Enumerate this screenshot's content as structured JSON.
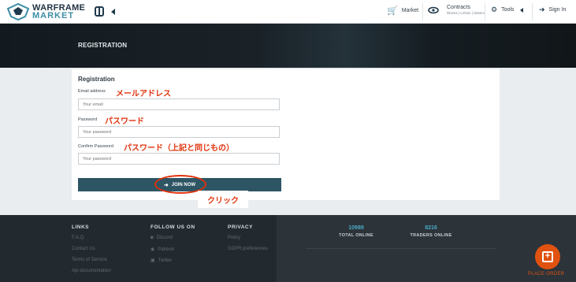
{
  "navbar": {
    "logo_line1": "WARFRAME",
    "logo_line2": "MARKET",
    "market_label": "Market",
    "contracts_label": "Contracts",
    "contracts_sub": "Rivens | Liches | Sisters",
    "tools_label": "Tools",
    "signin_label": "Sign In"
  },
  "hero": {
    "title": "REGISTRATION"
  },
  "form": {
    "title": "Registration",
    "email_label": "Email address",
    "email_placeholder": "Your email",
    "email_annotation": "メールアドレス",
    "password_label": "Password",
    "password_placeholder": "Your password",
    "password_annotation": "パスワード",
    "confirm_label": "Confirm Password",
    "confirm_placeholder": "Your password",
    "confirm_annotation": "パスワード（上記と同じもの）",
    "join_label": "JOIN NOW",
    "click_annotation": "クリック"
  },
  "footer": {
    "links_head": "LINKS",
    "links": [
      "F.A.Q.",
      "Contact Us",
      "Terms of Service",
      "Api documentation"
    ],
    "follow_head": "FOLLOW US ON",
    "follow": [
      "Discord",
      "Patreon",
      "Twitter"
    ],
    "privacy_head": "PRIVACY",
    "privacy": [
      "Policy",
      "GDPR preferences"
    ],
    "total_online": "10989",
    "total_online_label": "TOTAL ONLINE",
    "traders_online": "8216",
    "traders_online_label": "TRADERS ONLINE",
    "place_order_label": "PLACE ORDER"
  },
  "colors": {
    "accent": "#2e5564",
    "annotation": "#e0320c",
    "place_order": "#e0520f",
    "stat_number": "#4ba6c4"
  }
}
